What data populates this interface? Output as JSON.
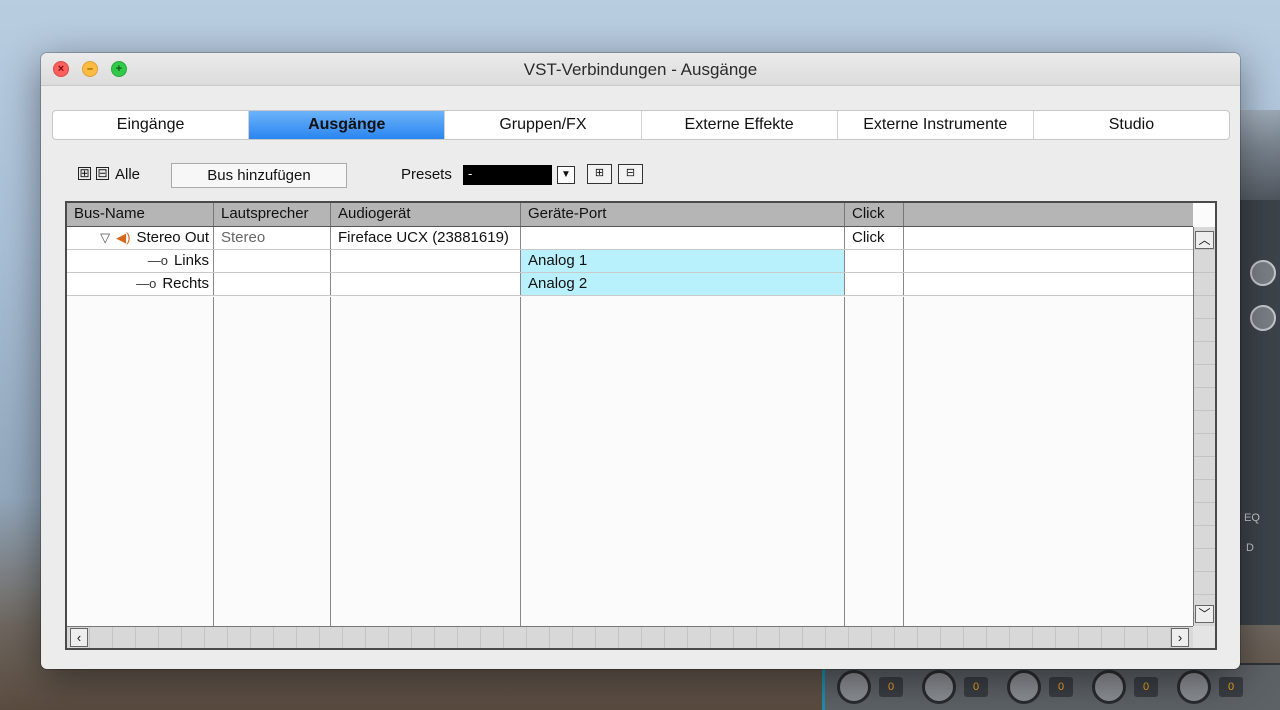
{
  "window": {
    "title": "VST-Verbindungen - Ausgänge"
  },
  "tabs": [
    {
      "label": "Eingänge",
      "active": false
    },
    {
      "label": "Ausgänge",
      "active": true
    },
    {
      "label": "Gruppen/FX",
      "active": false
    },
    {
      "label": "Externe Effekte",
      "active": false
    },
    {
      "label": "Externe Instrumente",
      "active": false
    },
    {
      "label": "Studio",
      "active": false
    }
  ],
  "toolbar": {
    "expand_icon": "⊞",
    "collapse_icon": "⊟",
    "all_label": "Alle",
    "add_bus_label": "Bus hinzufügen",
    "presets_label": "Presets",
    "presets_value": "-",
    "store_preset_icon": "store-preset-icon",
    "remove_preset_icon": "remove-preset-icon"
  },
  "table": {
    "columns": [
      "Bus-Name",
      "Lautsprecher",
      "Audiogerät",
      "Geräte-Port",
      "Click",
      ""
    ],
    "rows": [
      {
        "bus_name": "Stereo Out",
        "speaker": "Stereo",
        "device": "Fireface UCX (23881619)",
        "port": "",
        "click": "Click",
        "level": 0
      },
      {
        "bus_name": "Links",
        "speaker": "",
        "device": "",
        "port": "Analog 1",
        "click": "",
        "level": 1
      },
      {
        "bus_name": "Rechts",
        "speaker": "",
        "device": "",
        "port": "Analog 2",
        "click": "",
        "level": 1
      }
    ]
  },
  "mixer": {
    "labels": [
      "EQ",
      "D"
    ],
    "bottom_values": [
      "0",
      "0",
      "0",
      "0",
      "0"
    ]
  },
  "colors": {
    "active_tab": "#2a85f0",
    "selected_port": "#b8f0fb",
    "speaker_icon": "#d2691e"
  }
}
